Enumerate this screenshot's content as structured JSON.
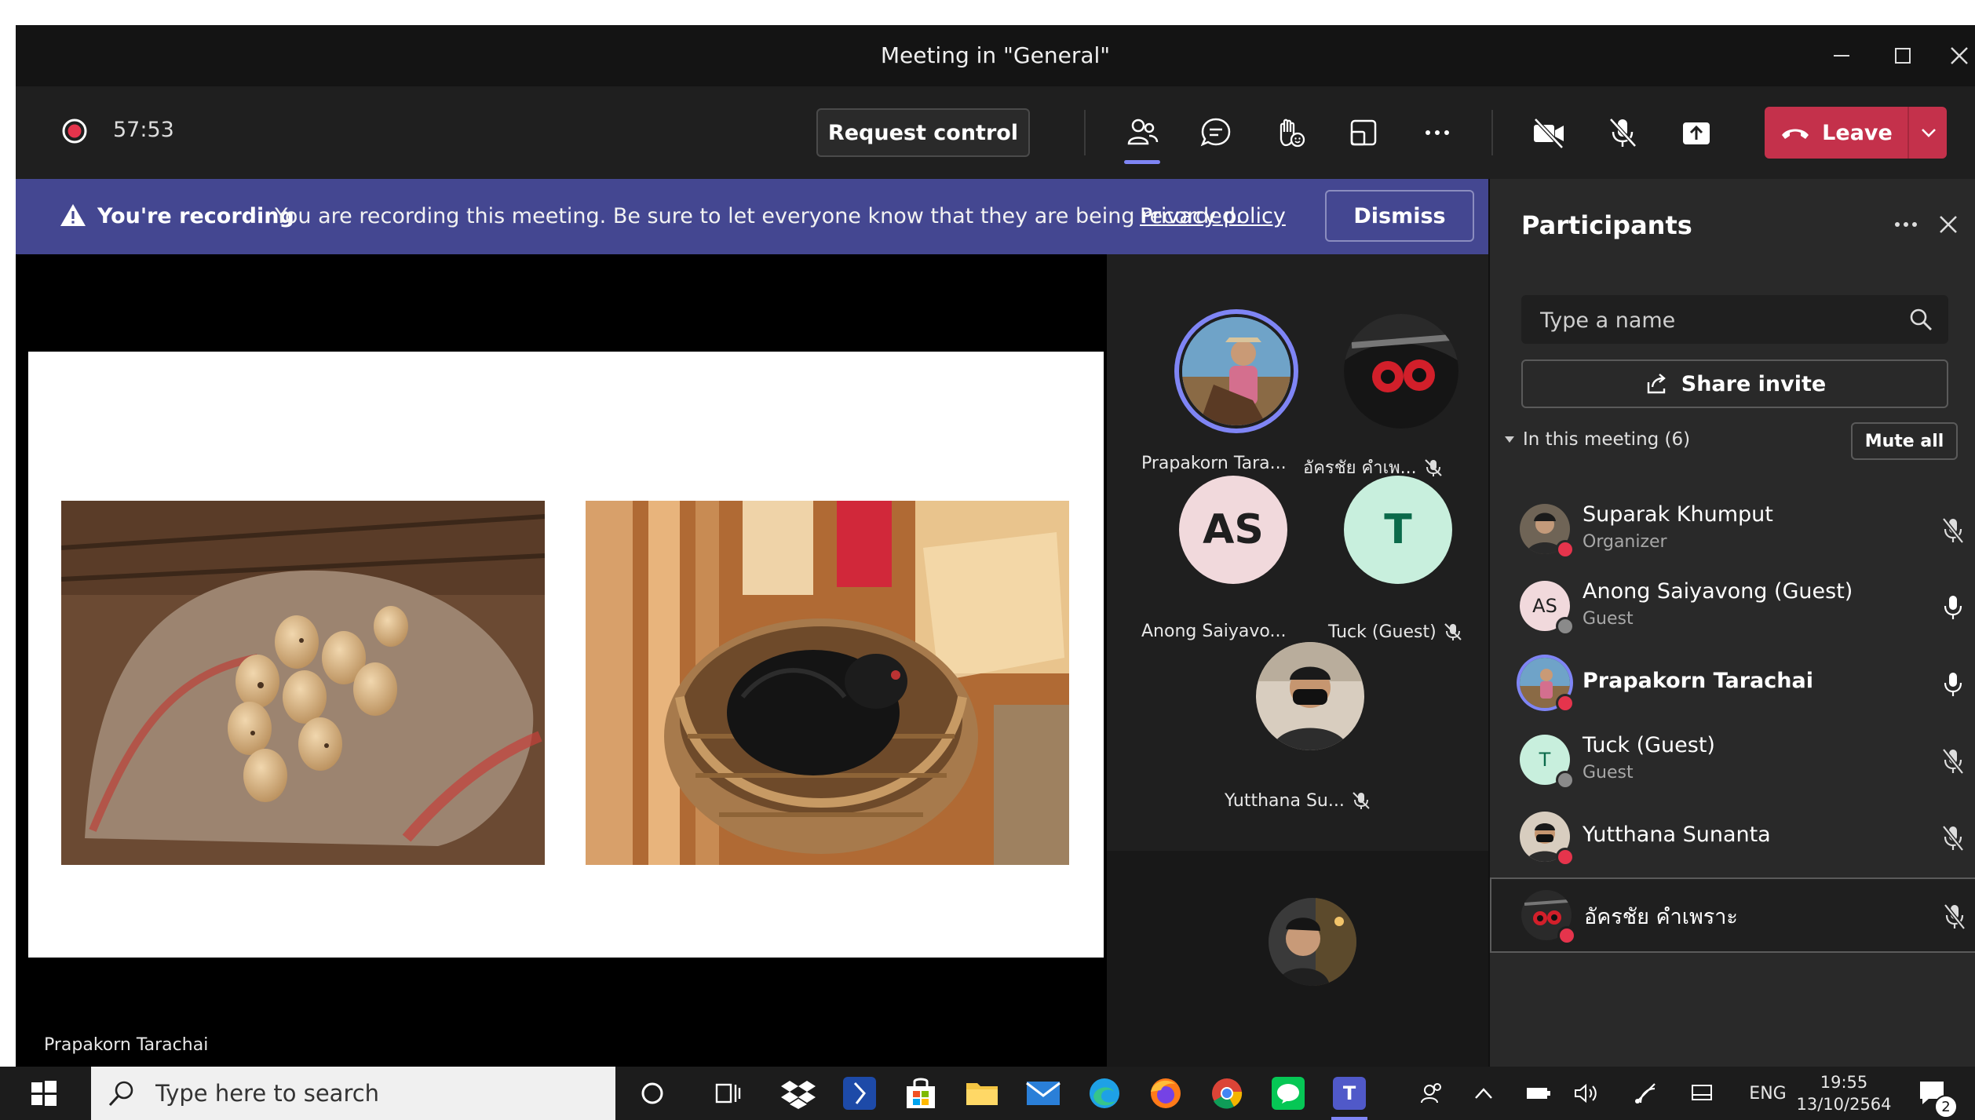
{
  "window": {
    "title": "Meeting in \"General\""
  },
  "toolbar": {
    "timer": "57:53",
    "request_control": "Request control",
    "leave": "Leave"
  },
  "banner": {
    "heading": "You're recording",
    "message": "You are recording this meeting. Be sure to let everyone know that they are being recorded.",
    "link": "Privacy policy",
    "dismiss": "Dismiss"
  },
  "stage": {
    "presenter": "Prapakorn Tarachai"
  },
  "gallery": {
    "tiles": [
      {
        "name": "Prapakorn Tara..."
      },
      {
        "name": "อัครชัย คำเพ..."
      },
      {
        "name": "Anong Saiyavo...",
        "initials": "AS"
      },
      {
        "name": "Tuck (Guest)",
        "initials": "T"
      },
      {
        "name": "Yutthana Su..."
      }
    ]
  },
  "panel": {
    "title": "Participants",
    "search_placeholder": "Type a name",
    "share_invite": "Share invite",
    "in_meeting": "In this meeting (6)",
    "mute_all": "Mute all",
    "participants": [
      {
        "name": "Suparak Khumput",
        "role": "Organizer",
        "mic": "muted"
      },
      {
        "name": "Anong Saiyavong (Guest)",
        "role": "Guest",
        "initials": "AS",
        "mic": "on"
      },
      {
        "name": "Prapakorn Tarachai",
        "role": "",
        "mic": "on"
      },
      {
        "name": "Tuck (Guest)",
        "role": "Guest",
        "initials": "T",
        "mic": "muted"
      },
      {
        "name": "Yutthana Sunanta",
        "role": "",
        "mic": "muted"
      },
      {
        "name": "อัครชัย คำเพราะ",
        "role": "",
        "mic": "muted"
      }
    ]
  },
  "taskbar": {
    "search_placeholder": "Type here to search",
    "language": "ENG",
    "time": "19:55",
    "date": "13/10/2564",
    "notifications": "2"
  },
  "colors": {
    "leave": "#c4314b",
    "banner": "#444791",
    "accent": "#7f85f5"
  }
}
